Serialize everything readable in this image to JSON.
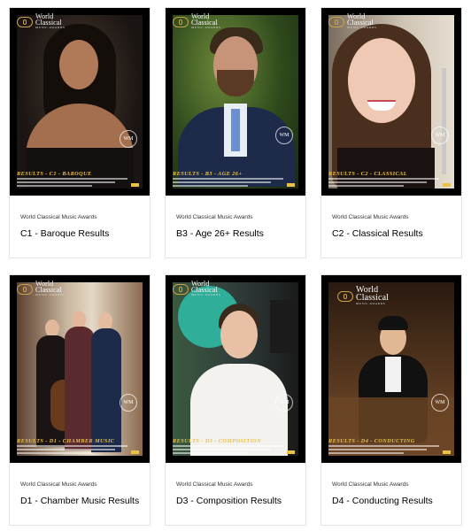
{
  "cards": [
    {
      "org": "World Classical Music Awards",
      "title": "C1 - Baroque Results",
      "banner": "RESULTS - C1 - BAROQUE"
    },
    {
      "org": "World Classical Music Awards",
      "title": "B3 - Age 26+ Results",
      "banner": "RESULTS - B3 - AGE 26+"
    },
    {
      "org": "World Classical Music Awards",
      "title": "C2 - Classical Results",
      "banner": "RESULTS - C2 - CLASSICAL"
    },
    {
      "org": "World Classical Music Awards",
      "title": "D1 - Chamber Music Results",
      "banner": "RESULTS - D1 - CHAMBER MUSIC"
    },
    {
      "org": "World Classical Music Awards",
      "title": "D3 - Composition Results",
      "banner": "RESULTS - D3 - COMPOSITION"
    },
    {
      "org": "World Classical Music Awards",
      "title": "D4 - Conducting Results",
      "banner": "RESULTS - D4 - CONDUCTING"
    }
  ],
  "logo": {
    "line1": "World",
    "line2": "Classical",
    "line3": "MUSIC AWARDS"
  },
  "seal": {
    "text": "WM"
  },
  "colors": {
    "cover_bg": "#000000",
    "accent_gold": "#e8c24a",
    "card_border": "#e4e4e4"
  }
}
